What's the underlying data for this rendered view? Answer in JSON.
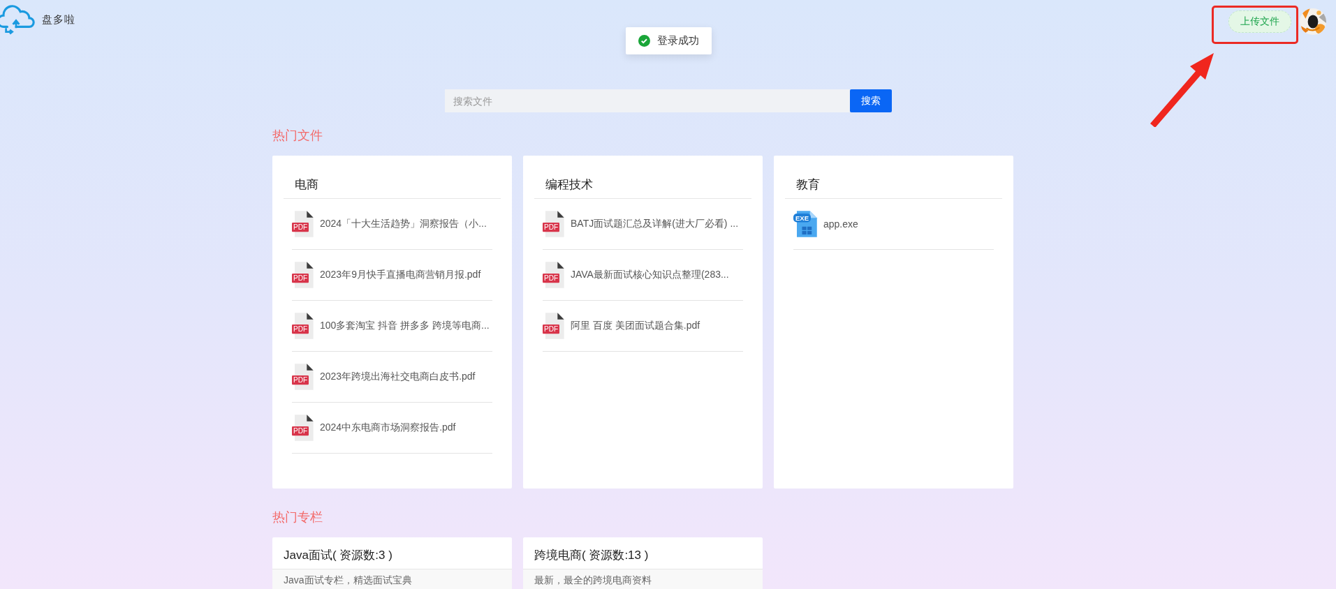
{
  "header": {
    "logo_text": "盘多啦",
    "upload_button": "上传文件"
  },
  "toast": {
    "kind": "success",
    "message": "登录成功"
  },
  "search": {
    "placeholder": "搜索文件",
    "button": "搜索"
  },
  "hot_files": {
    "title": "热门文件",
    "categories": [
      {
        "name": "电商",
        "files": [
          {
            "name": "2024「十大生活趋势」洞察报告（小...",
            "kind": "pdf",
            "badge": "PDF"
          },
          {
            "name": "2023年9月快手直播电商营销月报.pdf",
            "kind": "pdf",
            "badge": "PDF"
          },
          {
            "name": "100多套淘宝 抖音 拼多多 跨境等电商...",
            "kind": "pdf",
            "badge": "PDF"
          },
          {
            "name": "2023年跨境出海社交电商白皮书.pdf",
            "kind": "pdf",
            "badge": "PDF"
          },
          {
            "name": "2024中东电商市场洞察报告.pdf",
            "kind": "pdf",
            "badge": "PDF"
          }
        ]
      },
      {
        "name": "编程技术",
        "files": [
          {
            "name": "BATJ面试题汇总及详解(进大厂必看) ...",
            "kind": "pdf",
            "badge": "PDF"
          },
          {
            "name": "JAVA最新面试核心知识点整理(283...",
            "kind": "pdf",
            "badge": "PDF"
          },
          {
            "name": "阿里 百度 美团面试题合集.pdf",
            "kind": "pdf",
            "badge": "PDF"
          }
        ]
      },
      {
        "name": "教育",
        "files": [
          {
            "name": "app.exe",
            "kind": "exe",
            "badge": "EXE"
          }
        ]
      }
    ]
  },
  "hot_columns": {
    "title": "热门专栏",
    "columns": [
      {
        "title": "Java面试( 资源数:3 )",
        "description": "Java面试专栏，精选面试宝典"
      },
      {
        "title": "跨境电商( 资源数:13 )",
        "description": "最新，最全的跨境电商资料"
      }
    ]
  }
}
